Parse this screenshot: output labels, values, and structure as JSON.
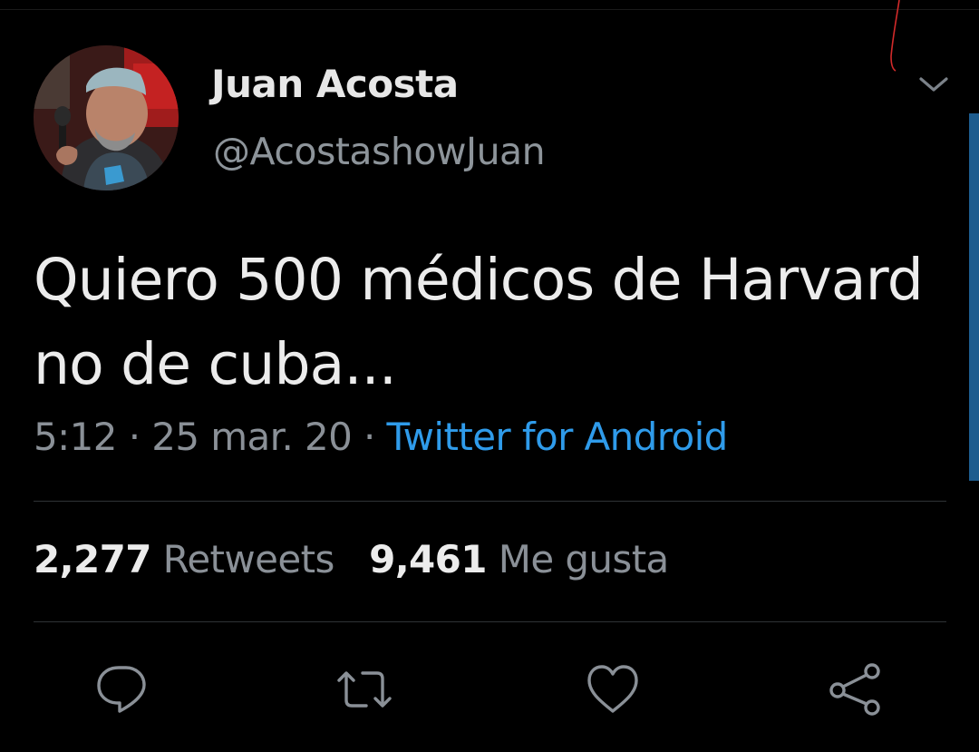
{
  "tweet": {
    "author": {
      "display_name": "Juan Acosta",
      "handle": "@AcostashowJuan",
      "avatar_icon": "user-avatar-photo"
    },
    "text_line1": "Quiero 500 médicos de Harvard",
    "text_line2": "no de cuba...",
    "time": "5:12",
    "date": "25 mar. 20",
    "separator": "·",
    "source": "Twitter for Android",
    "stats": {
      "retweets_count": "2,277",
      "retweets_label": "Retweets",
      "likes_count": "9,461",
      "likes_label": "Me gusta"
    },
    "actions": [
      {
        "icon": "reply-icon"
      },
      {
        "icon": "retweet-icon"
      },
      {
        "icon": "like-icon"
      },
      {
        "icon": "share-icon"
      }
    ],
    "menu_icon": "chevron-down-icon"
  },
  "colors": {
    "background": "#000000",
    "primary_text": "#ececec",
    "secondary_text": "#8a9097",
    "link": "#2f9bea",
    "divider": "#2f3336",
    "scrollbar": "#1d5c8e"
  }
}
